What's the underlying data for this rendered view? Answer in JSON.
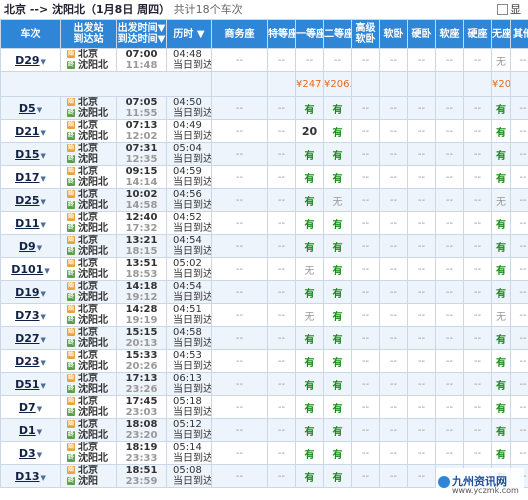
{
  "header": {
    "route": "北京 --> 沈阳北（1月8日 周四）",
    "count_text": "共计18个车次",
    "extra_label": "显"
  },
  "columns": {
    "train": "车次",
    "stations": [
      "出发站",
      "到达站"
    ],
    "times": [
      "出发时间▼",
      "到达时间▼"
    ],
    "duration": "历时 ▼",
    "seats": [
      "商务座",
      "特等座",
      "一等座",
      "二等座",
      "高级软卧",
      "软卧",
      "硬卧",
      "软座",
      "硬座",
      "无座",
      "其他"
    ]
  },
  "trains": [
    {
      "no": "D29",
      "from": "北京",
      "to": "沈阳北",
      "dep": "07:00",
      "arr": "11:48",
      "dur": "04:48",
      "note": "当日到达",
      "seats": [
        "--",
        "--",
        "--",
        "--",
        "--",
        "--",
        "--",
        "--",
        "--",
        "无",
        "--"
      ]
    },
    {
      "price_row": true,
      "seats": [
        "",
        "",
        "¥247.0",
        "¥206.0",
        "",
        "",
        "",
        "",
        "",
        "¥206.0",
        ""
      ]
    },
    {
      "no": "D5",
      "from": "北京",
      "to": "沈阳北",
      "dep": "07:05",
      "arr": "11:55",
      "dur": "04:50",
      "note": "当日到达",
      "seats": [
        "--",
        "--",
        "有",
        "有",
        "--",
        "--",
        "--",
        "--",
        "--",
        "有",
        "--"
      ]
    },
    {
      "no": "D21",
      "from": "北京",
      "to": "沈阳北",
      "dep": "07:13",
      "arr": "12:02",
      "dur": "04:49",
      "note": "当日到达",
      "seats": [
        "--",
        "--",
        "20",
        "有",
        "--",
        "--",
        "--",
        "--",
        "--",
        "有",
        "--"
      ]
    },
    {
      "no": "D15",
      "from": "北京",
      "to": "沈阳",
      "dep": "07:31",
      "arr": "12:35",
      "dur": "05:04",
      "note": "当日到达",
      "seats": [
        "--",
        "--",
        "有",
        "有",
        "--",
        "--",
        "--",
        "--",
        "--",
        "有",
        "--"
      ]
    },
    {
      "no": "D17",
      "from": "北京",
      "to": "沈阳北",
      "dep": "09:15",
      "arr": "14:14",
      "dur": "04:59",
      "note": "当日到达",
      "seats": [
        "--",
        "--",
        "有",
        "有",
        "--",
        "--",
        "--",
        "--",
        "--",
        "有",
        "--"
      ]
    },
    {
      "no": "D25",
      "from": "北京",
      "to": "沈阳北",
      "dep": "10:02",
      "arr": "14:58",
      "dur": "04:56",
      "note": "当日到达",
      "seats": [
        "--",
        "--",
        "有",
        "无",
        "--",
        "--",
        "--",
        "--",
        "--",
        "无",
        "--"
      ]
    },
    {
      "no": "D11",
      "from": "北京",
      "to": "沈阳北",
      "dep": "12:40",
      "arr": "17:32",
      "dur": "04:52",
      "note": "当日到达",
      "seats": [
        "--",
        "--",
        "有",
        "有",
        "--",
        "--",
        "--",
        "--",
        "--",
        "有",
        "--"
      ]
    },
    {
      "no": "D9",
      "from": "北京",
      "to": "沈阳北",
      "dep": "13:21",
      "arr": "18:15",
      "dur": "04:54",
      "note": "当日到达",
      "seats": [
        "--",
        "--",
        "有",
        "有",
        "--",
        "--",
        "--",
        "--",
        "--",
        "有",
        "--"
      ]
    },
    {
      "no": "D101",
      "from": "北京",
      "to": "沈阳北",
      "dep": "13:51",
      "arr": "18:53",
      "dur": "05:02",
      "note": "当日到达",
      "seats": [
        "--",
        "--",
        "无",
        "有",
        "--",
        "--",
        "--",
        "--",
        "--",
        "有",
        "--"
      ]
    },
    {
      "no": "D19",
      "from": "北京",
      "to": "沈阳北",
      "dep": "14:18",
      "arr": "19:12",
      "dur": "04:54",
      "note": "当日到达",
      "seats": [
        "--",
        "--",
        "有",
        "有",
        "--",
        "--",
        "--",
        "--",
        "--",
        "有",
        "--"
      ]
    },
    {
      "no": "D73",
      "from": "北京",
      "to": "沈阳北",
      "dep": "14:28",
      "arr": "19:19",
      "dur": "04:51",
      "note": "当日到达",
      "seats": [
        "--",
        "--",
        "无",
        "有",
        "--",
        "--",
        "--",
        "--",
        "--",
        "无",
        "--"
      ]
    },
    {
      "no": "D27",
      "from": "北京",
      "to": "沈阳北",
      "dep": "15:15",
      "arr": "20:13",
      "dur": "04:58",
      "note": "当日到达",
      "seats": [
        "--",
        "--",
        "有",
        "有",
        "--",
        "--",
        "--",
        "--",
        "--",
        "有",
        "--"
      ]
    },
    {
      "no": "D23",
      "from": "北京",
      "to": "沈阳北",
      "dep": "15:33",
      "arr": "20:26",
      "dur": "04:53",
      "note": "当日到达",
      "seats": [
        "--",
        "--",
        "有",
        "有",
        "--",
        "--",
        "--",
        "--",
        "--",
        "有",
        "--"
      ]
    },
    {
      "no": "D51",
      "from": "北京",
      "to": "沈阳北",
      "dep": "17:13",
      "arr": "23:26",
      "dur": "06:13",
      "note": "当日到达",
      "seats": [
        "--",
        "--",
        "有",
        "有",
        "--",
        "--",
        "--",
        "--",
        "--",
        "有",
        "--"
      ]
    },
    {
      "no": "D7",
      "from": "北京",
      "to": "沈阳北",
      "dep": "17:45",
      "arr": "23:03",
      "dur": "05:18",
      "note": "当日到达",
      "seats": [
        "--",
        "--",
        "有",
        "有",
        "--",
        "--",
        "--",
        "--",
        "--",
        "有",
        "--"
      ]
    },
    {
      "no": "D1",
      "from": "北京",
      "to": "沈阳北",
      "dep": "18:08",
      "arr": "23:20",
      "dur": "05:12",
      "note": "当日到达",
      "seats": [
        "--",
        "--",
        "有",
        "有",
        "--",
        "--",
        "--",
        "--",
        "--",
        "有",
        "--"
      ]
    },
    {
      "no": "D3",
      "from": "北京",
      "to": "沈阳北",
      "dep": "18:19",
      "arr": "23:33",
      "dur": "05:14",
      "note": "当日到达",
      "seats": [
        "--",
        "--",
        "有",
        "有",
        "--",
        "--",
        "--",
        "--",
        "--",
        "有",
        "--"
      ]
    },
    {
      "no": "D13",
      "from": "北京",
      "to": "沈阳",
      "dep": "18:51",
      "arr": "23:59",
      "dur": "05:08",
      "note": "当日到达",
      "seats": [
        "--",
        "--",
        "有",
        "有",
        "--",
        "--",
        "--",
        "--",
        "--",
        "有",
        "--"
      ]
    }
  ],
  "labels": {
    "start_badge": "始",
    "end_badge": "终"
  },
  "watermark": {
    "title": "九州资讯网",
    "url": "www.yczmk.com"
  }
}
